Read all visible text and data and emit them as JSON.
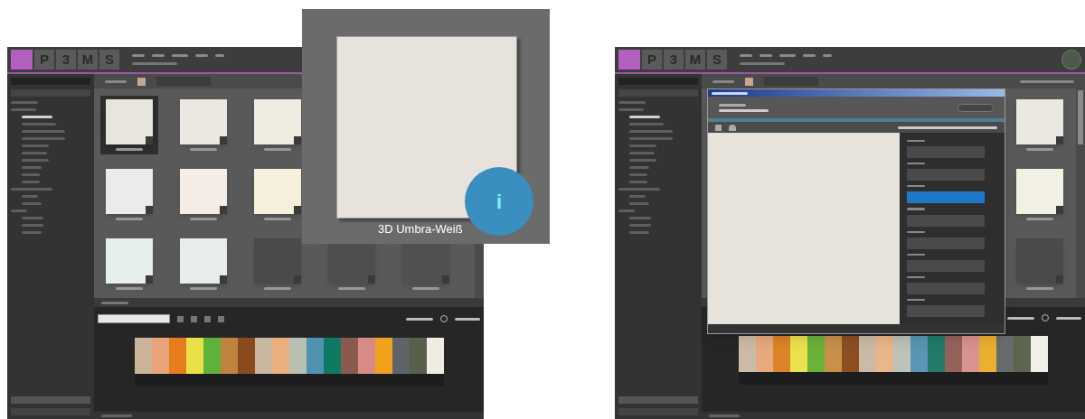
{
  "screens": [
    {
      "kind": "grid",
      "logo": [
        "P",
        "3",
        "M",
        "S"
      ],
      "avatar": false,
      "tile_rows": [
        [
          {
            "color": "#e8e5de",
            "selected": true
          },
          {
            "color": "#ebe8e1",
            "selected": false
          },
          {
            "color": "#eeebe0",
            "selected": false
          }
        ],
        [
          {
            "color": "#ebebea",
            "selected": false
          },
          {
            "color": "#f4ece5",
            "selected": false
          },
          {
            "color": "#f6efdc",
            "selected": false
          }
        ],
        [
          {
            "color": "#e6efea",
            "selected": false
          },
          {
            "color": "#e9ecec",
            "selected": false
          },
          {
            "color": "#4a4a4a",
            "selected": false
          },
          {
            "color": "#4e4e4e",
            "selected": false
          },
          {
            "color": "#505050",
            "selected": false
          }
        ]
      ],
      "swatches": [
        {
          "color": "#c9b49a"
        },
        {
          "color": "#e8a378"
        },
        {
          "color": "#e57c1d"
        },
        {
          "color": "#e9e04a"
        },
        {
          "color": "#5db33a"
        },
        {
          "color": "#c0823f"
        },
        {
          "color": "#8a4a1e"
        },
        {
          "color": "#c8b8a2"
        },
        {
          "color": "#e9b07e"
        },
        {
          "color": "#b8c0b2"
        },
        {
          "color": "#4f93b0"
        },
        {
          "color": "#0e7a64"
        },
        {
          "color": "#8a5a4e"
        },
        {
          "color": "#d98a86"
        },
        {
          "color": "#f0a21e"
        },
        {
          "color": "#5e6468"
        },
        {
          "color": "#56604a"
        },
        {
          "color": "#f0ece4"
        }
      ]
    },
    {
      "kind": "dialog",
      "logo": [
        "P",
        "3",
        "M",
        "S"
      ],
      "avatar": true,
      "tile_rows": [
        [
          {
            "color": "#ebe8e1",
            "selected": false
          }
        ],
        [
          {
            "color": "#f1f0e2",
            "selected": false
          }
        ],
        [
          {
            "color": "#4a4a4a",
            "selected": false
          }
        ]
      ],
      "dialog": {
        "fields": [
          {
            "selected": false
          },
          {
            "selected": false
          },
          {
            "selected": true
          },
          {
            "selected": false
          },
          {
            "selected": false
          },
          {
            "selected": false
          },
          {
            "selected": false
          },
          {
            "selected": false
          }
        ]
      },
      "swatches": [
        {
          "color": "#cbbca6"
        },
        {
          "color": "#e8a97e"
        },
        {
          "color": "#dc8428"
        },
        {
          "color": "#ece14e"
        },
        {
          "color": "#6bb23a"
        },
        {
          "color": "#c8914a"
        },
        {
          "color": "#8d4f22"
        },
        {
          "color": "#cbbba6"
        },
        {
          "color": "#e9b789"
        },
        {
          "color": "#bdc3b8"
        },
        {
          "color": "#5a95b3"
        },
        {
          "color": "#217b68"
        },
        {
          "color": "#96635a"
        },
        {
          "color": "#d99391"
        },
        {
          "color": "#ebb032"
        },
        {
          "color": "#666b6c"
        },
        {
          "color": "#5c6550"
        },
        {
          "color": "#f2efe9"
        }
      ]
    }
  ],
  "zoom": {
    "label": "3D Umbra-Weiß",
    "badge": "i"
  }
}
